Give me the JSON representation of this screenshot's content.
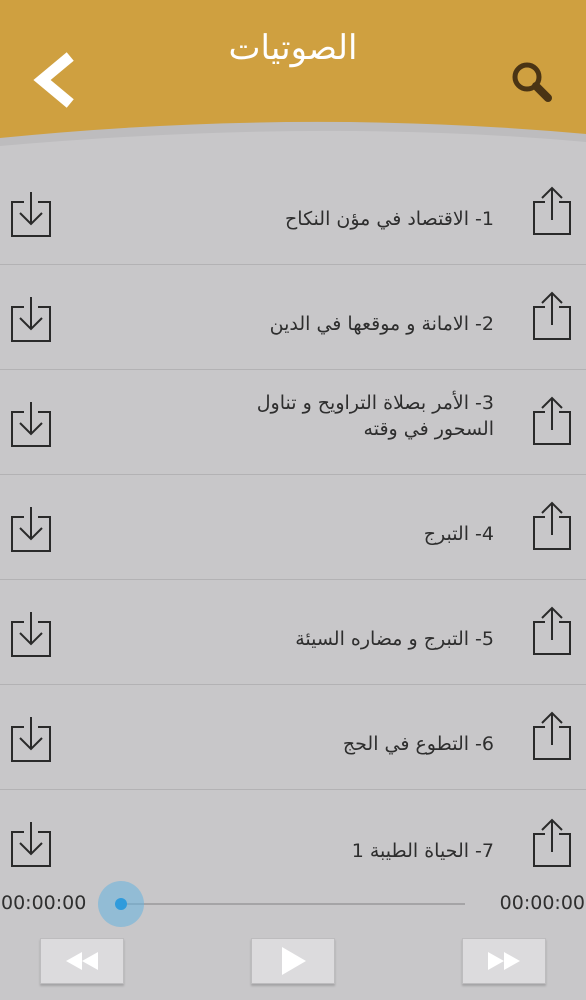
{
  "header": {
    "title": "الصوتيات",
    "bg_color": "#cfa040",
    "back_icon": "chevron-left-icon",
    "search_icon": "search-icon"
  },
  "tracks": [
    {
      "title": "1- الاقتصاد في مؤن النكاح"
    },
    {
      "title": "2- الامانة و موقعها في الدين"
    },
    {
      "title": "3- الأمر بصلاة التراويح و تناول السحور في وقته"
    },
    {
      "title": "4- التبرج"
    },
    {
      "title": "5- التبرج و مضاره السيئة"
    },
    {
      "title": "6- التطوع في الحج"
    },
    {
      "title": "7- الحياة الطيبة 1"
    }
  ],
  "player": {
    "current_time": "00:00:00",
    "total_time": "00:00:00",
    "progress": 0,
    "accent_color": "#2f9bdc"
  }
}
